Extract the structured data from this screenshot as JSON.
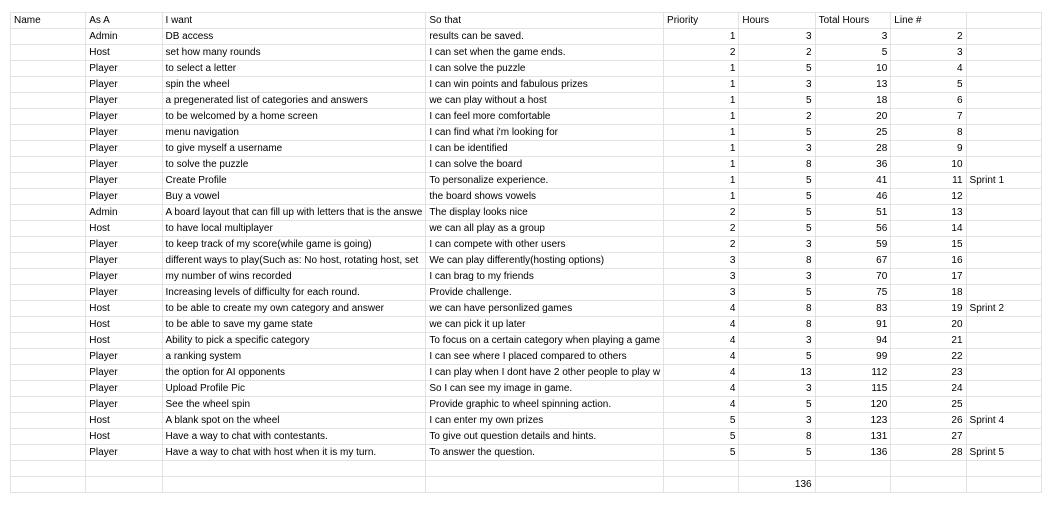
{
  "headers": [
    "Name",
    "As A",
    "I want",
    "So that",
    "Priority",
    "Hours",
    "Total Hours",
    "Line #",
    ""
  ],
  "rows": [
    {
      "name": "",
      "as_a": "Admin",
      "want": "DB access",
      "so_that": "results can be saved.",
      "priority": "1",
      "hours": "3",
      "total": "3",
      "line": "2",
      "sprint": ""
    },
    {
      "name": "",
      "as_a": "Host",
      "want": "set how many rounds",
      "so_that": "I can set when the game ends.",
      "priority": "2",
      "hours": "2",
      "total": "5",
      "line": "3",
      "sprint": ""
    },
    {
      "name": "",
      "as_a": "Player",
      "want": "to select a letter",
      "so_that": "I can solve the puzzle",
      "priority": "1",
      "hours": "5",
      "total": "10",
      "line": "4",
      "sprint": ""
    },
    {
      "name": "",
      "as_a": "Player",
      "want": "spin the wheel",
      "so_that": "I can win points and fabulous prizes",
      "priority": "1",
      "hours": "3",
      "total": "13",
      "line": "5",
      "sprint": ""
    },
    {
      "name": "",
      "as_a": "Player",
      "want": "a pregenerated list of categories and answers",
      "so_that": "we can play without a host",
      "priority": "1",
      "hours": "5",
      "total": "18",
      "line": "6",
      "sprint": ""
    },
    {
      "name": "",
      "as_a": "Player",
      "want": "to be welcomed by a home screen",
      "so_that": "I can feel more comfortable",
      "priority": "1",
      "hours": "2",
      "total": "20",
      "line": "7",
      "sprint": ""
    },
    {
      "name": "",
      "as_a": "Player",
      "want": "menu navigation",
      "so_that": "I can find what i'm looking for",
      "priority": "1",
      "hours": "5",
      "total": "25",
      "line": "8",
      "sprint": ""
    },
    {
      "name": "",
      "as_a": "Player",
      "want": "to give myself a username",
      "so_that": "I can be identified",
      "priority": "1",
      "hours": "3",
      "total": "28",
      "line": "9",
      "sprint": ""
    },
    {
      "name": "",
      "as_a": "Player",
      "want": "to solve the puzzle",
      "so_that": "I can solve the board",
      "priority": "1",
      "hours": "8",
      "total": "36",
      "line": "10",
      "sprint": ""
    },
    {
      "name": "",
      "as_a": "Player",
      "want": "Create Profile",
      "so_that": "To personalize experience.",
      "priority": "1",
      "hours": "5",
      "total": "41",
      "line": "11",
      "sprint": "Sprint 1"
    },
    {
      "name": "",
      "as_a": "Player",
      "want": "Buy a vowel",
      "so_that": "the board shows vowels",
      "priority": "1",
      "hours": "5",
      "total": "46",
      "line": "12",
      "sprint": ""
    },
    {
      "name": "",
      "as_a": "Admin",
      "want": "A board layout that can fill up with letters that is the answe",
      "so_that": "The display looks nice",
      "priority": "2",
      "hours": "5",
      "total": "51",
      "line": "13",
      "sprint": ""
    },
    {
      "name": "",
      "as_a": "Host",
      "want": "to have local multiplayer",
      "so_that": "we can all play as a group",
      "priority": "2",
      "hours": "5",
      "total": "56",
      "line": "14",
      "sprint": ""
    },
    {
      "name": "",
      "as_a": "Player",
      "want": "to keep track of my score(while game is going)",
      "so_that": "I can compete with other users",
      "priority": "2",
      "hours": "3",
      "total": "59",
      "line": "15",
      "sprint": ""
    },
    {
      "name": "",
      "as_a": "Player",
      "want": "different ways to play(Such as: No host, rotating host, set",
      "so_that": "We can play differently(hosting options)",
      "priority": "3",
      "hours": "8",
      "total": "67",
      "line": "16",
      "sprint": ""
    },
    {
      "name": "",
      "as_a": "Player",
      "want": "my number of wins recorded",
      "so_that": "I can brag to my friends",
      "priority": "3",
      "hours": "3",
      "total": "70",
      "line": "17",
      "sprint": ""
    },
    {
      "name": "",
      "as_a": "Player",
      "want": "Increasing levels of difficulty for each round.",
      "so_that": "Provide challenge.",
      "priority": "3",
      "hours": "5",
      "total": "75",
      "line": "18",
      "sprint": ""
    },
    {
      "name": "",
      "as_a": "Host",
      "want": "to be able to create my own category and answer",
      "so_that": "we can have personlized games",
      "priority": "4",
      "hours": "8",
      "total": "83",
      "line": "19",
      "sprint": "Sprint 2"
    },
    {
      "name": "",
      "as_a": "Host",
      "want": "to be able to save my game state",
      "so_that": "we can pick it up later",
      "priority": "4",
      "hours": "8",
      "total": "91",
      "line": "20",
      "sprint": ""
    },
    {
      "name": "",
      "as_a": "Host",
      "want": "Ability to pick a specific category",
      "so_that": "To focus on a certain category when playing a game",
      "priority": "4",
      "hours": "3",
      "total": "94",
      "line": "21",
      "sprint": ""
    },
    {
      "name": "",
      "as_a": "Player",
      "want": "a ranking system",
      "so_that": "I can see where I placed compared to others",
      "priority": "4",
      "hours": "5",
      "total": "99",
      "line": "22",
      "sprint": ""
    },
    {
      "name": "",
      "as_a": "Player",
      "want": "the option for AI opponents",
      "so_that": "I can play when I dont have 2 other people to play w",
      "priority": "4",
      "hours": "13",
      "total": "112",
      "line": "23",
      "sprint": ""
    },
    {
      "name": "",
      "as_a": "Player",
      "want": "Upload Profile Pic",
      "so_that": "So I can see my image in game.",
      "priority": "4",
      "hours": "3",
      "total": "115",
      "line": "24",
      "sprint": ""
    },
    {
      "name": "",
      "as_a": "Player",
      "want": "See the wheel spin",
      "so_that": "Provide graphic to wheel spinning action.",
      "priority": "4",
      "hours": "5",
      "total": "120",
      "line": "25",
      "sprint": ""
    },
    {
      "name": "",
      "as_a": "Host",
      "want": "A blank spot on the wheel",
      "so_that": "I can enter my own prizes",
      "priority": "5",
      "hours": "3",
      "total": "123",
      "line": "26",
      "sprint": "Sprint 4"
    },
    {
      "name": "",
      "as_a": "Host",
      "want": "Have a way to chat with contestants.",
      "so_that": "To give out question details and hints.",
      "priority": "5",
      "hours": "8",
      "total": "131",
      "line": "27",
      "sprint": ""
    },
    {
      "name": "",
      "as_a": "Player",
      "want": "Have a way to chat with host when it is my turn.",
      "so_that": "To answer the question.",
      "priority": "5",
      "hours": "5",
      "total": "136",
      "line": "28",
      "sprint": "Sprint 5"
    }
  ],
  "footer": {
    "blank_row": true,
    "total_hours_sum": "136"
  }
}
